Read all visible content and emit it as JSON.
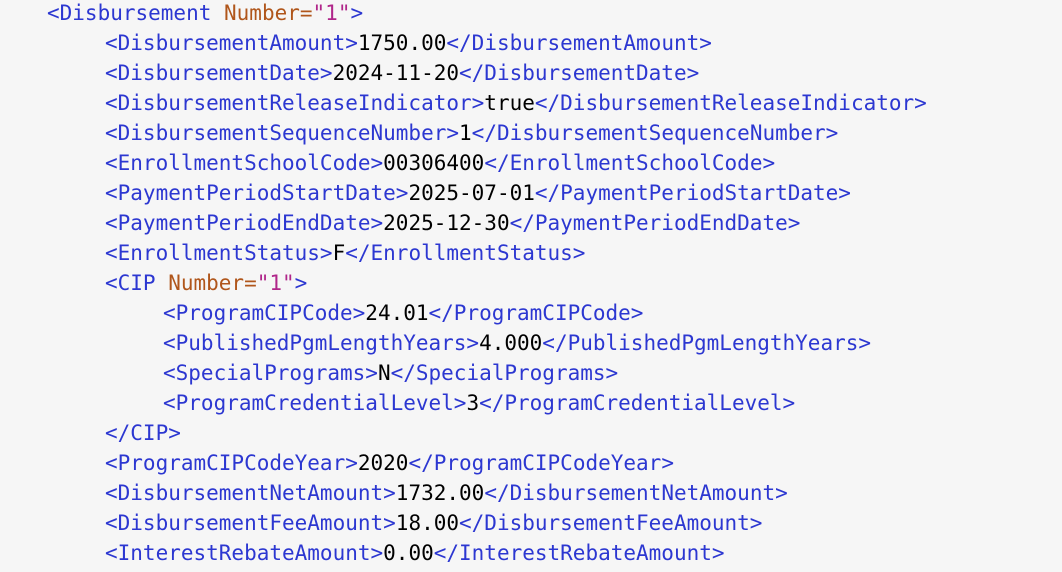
{
  "colors": {
    "tag": "#2c37d1",
    "attribute_name": "#b0561b",
    "attribute_value": "#b0268a",
    "text": "#000000",
    "background": "#f6f6f6"
  },
  "lines": [
    {
      "indent": 1,
      "kind": "open_attr",
      "tag": "Disbursement",
      "attr_name": "Number",
      "attr_value": "\"1\""
    },
    {
      "indent": 2,
      "kind": "element",
      "tag": "DisbursementAmount",
      "text": "1750.00"
    },
    {
      "indent": 2,
      "kind": "element",
      "tag": "DisbursementDate",
      "text": "2024-11-20"
    },
    {
      "indent": 2,
      "kind": "element",
      "tag": "DisbursementReleaseIndicator",
      "text": "true"
    },
    {
      "indent": 2,
      "kind": "element",
      "tag": "DisbursementSequenceNumber",
      "text": "1"
    },
    {
      "indent": 2,
      "kind": "element",
      "tag": "EnrollmentSchoolCode",
      "text": "00306400"
    },
    {
      "indent": 2,
      "kind": "element",
      "tag": "PaymentPeriodStartDate",
      "text": "2025-07-01"
    },
    {
      "indent": 2,
      "kind": "element",
      "tag": "PaymentPeriodEndDate",
      "text": "2025-12-30"
    },
    {
      "indent": 2,
      "kind": "element",
      "tag": "EnrollmentStatus",
      "text": "F"
    },
    {
      "indent": 2,
      "kind": "open_attr",
      "tag": "CIP",
      "attr_name": "Number",
      "attr_value": "\"1\""
    },
    {
      "indent": 3,
      "kind": "element",
      "tag": "ProgramCIPCode",
      "text": "24.01"
    },
    {
      "indent": 3,
      "kind": "element",
      "tag": "PublishedPgmLengthYears",
      "text": "4.000"
    },
    {
      "indent": 3,
      "kind": "element",
      "tag": "SpecialPrograms",
      "text": "N"
    },
    {
      "indent": 3,
      "kind": "element",
      "tag": "ProgramCredentialLevel",
      "text": "3"
    },
    {
      "indent": 2,
      "kind": "close",
      "tag": "CIP"
    },
    {
      "indent": 2,
      "kind": "element",
      "tag": "ProgramCIPCodeYear",
      "text": "2020"
    },
    {
      "indent": 2,
      "kind": "element",
      "tag": "DisbursementNetAmount",
      "text": "1732.00"
    },
    {
      "indent": 2,
      "kind": "element",
      "tag": "DisbursementFeeAmount",
      "text": "18.00"
    },
    {
      "indent": 2,
      "kind": "element",
      "tag": "InterestRebateAmount",
      "text": "0.00"
    }
  ]
}
